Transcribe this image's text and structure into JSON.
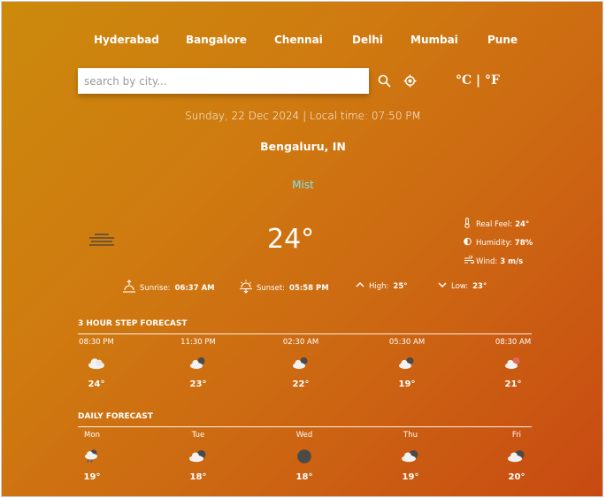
{
  "cities": [
    "Hyderabad",
    "Bangalore",
    "Chennai",
    "Delhi",
    "Mumbai",
    "Pune"
  ],
  "search": {
    "placeholder": "search by city..."
  },
  "units": {
    "celsius": "°C",
    "separator": "|",
    "fahrenheit": "°F"
  },
  "datetime": "Sunday, 22 Dec 2024 | Local time: 07:50 PM",
  "location": "Bengaluru, IN",
  "condition": "Mist",
  "current": {
    "temp": "24°",
    "real_feel_label": "Real Feel:",
    "real_feel": "24°",
    "humidity_label": "Humidity:",
    "humidity": "78%",
    "wind_label": "Wind:",
    "wind": "3 m/s"
  },
  "sun": {
    "sunrise_label": "Sunrise:",
    "sunrise": "06:37 AM",
    "sunset_label": "Sunset:",
    "sunset": "05:58 PM",
    "high_label": "High:",
    "high": "25°",
    "low_label": "Low:",
    "low": "23°"
  },
  "hourly": {
    "title": "3 HOUR STEP FORECAST",
    "items": [
      {
        "time": "08:30 PM",
        "icon": "cloud-icon",
        "temp": "24°"
      },
      {
        "time": "11:30 PM",
        "icon": "night-cloud-icon",
        "temp": "23°"
      },
      {
        "time": "02:30 AM",
        "icon": "night-cloud-icon",
        "temp": "22°"
      },
      {
        "time": "05:30 AM",
        "icon": "night-cloud-icon",
        "temp": "19°"
      },
      {
        "time": "08:30 AM",
        "icon": "sun-cloud-icon",
        "temp": "21°"
      }
    ]
  },
  "daily": {
    "title": "DAILY FORECAST",
    "items": [
      {
        "day": "Mon",
        "icon": "rain-cloud-icon",
        "temp": "19°"
      },
      {
        "day": "Tue",
        "icon": "dark-cloud-icon",
        "temp": "18°"
      },
      {
        "day": "Wed",
        "icon": "overcast-icon",
        "temp": "18°"
      },
      {
        "day": "Thu",
        "icon": "dark-cloud-icon",
        "temp": "19°"
      },
      {
        "day": "Fri",
        "icon": "dark-cloud-icon",
        "temp": "20°"
      }
    ]
  }
}
